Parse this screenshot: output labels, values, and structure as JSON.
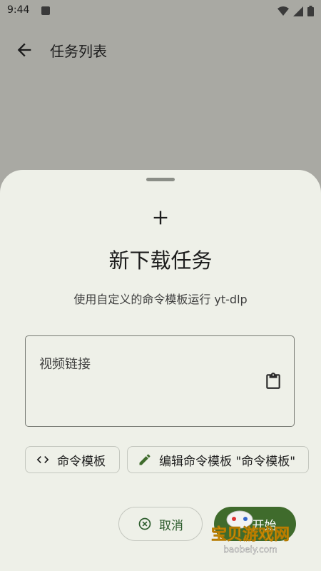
{
  "status_bar": {
    "time": "9:44"
  },
  "app_bar": {
    "title": "任务列表"
  },
  "sheet": {
    "title": "新下载任务",
    "subtitle": "使用自定义的命令模板运行 yt-dlp",
    "url_field": {
      "label": "视频链接"
    },
    "chips": {
      "template": "命令模板",
      "edit_template": "编辑命令模板 \"命令模板\""
    },
    "cancel": "取消",
    "start": "开始"
  },
  "watermark": {
    "brand": "宝贝游戏网",
    "site": "baobeiy.com"
  },
  "colors": {
    "accent": "#3f6b2c",
    "sheet_bg": "#eef0e8",
    "scrim": "#a9a9a3"
  }
}
